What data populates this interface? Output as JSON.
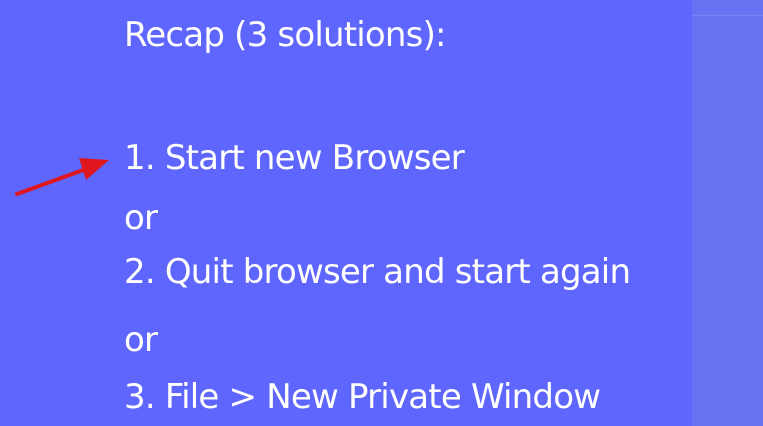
{
  "slide": {
    "title": "Recap (3 solutions):",
    "line1": "1. Start new Browser",
    "or1": "or",
    "line2": "2. Quit browser and start again",
    "or2": "or",
    "line3": "3. File > New Private Window"
  },
  "annotation": {
    "icon": "red-arrow-icon",
    "color": "#e0161f"
  },
  "colors": {
    "main_background": "#5f66fd",
    "side_background": "#6672f2",
    "text": "#ffffff"
  }
}
